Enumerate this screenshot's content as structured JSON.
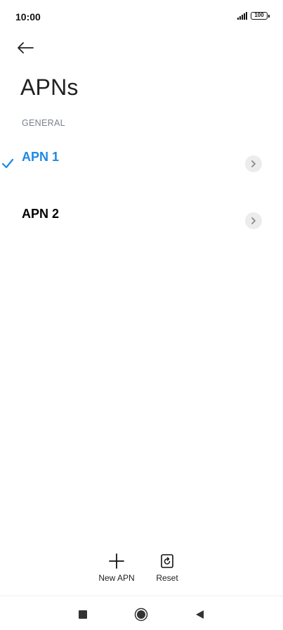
{
  "status_bar": {
    "time": "10:00",
    "battery": "100",
    "icons": [
      "signal-icon",
      "battery-icon"
    ]
  },
  "header": {
    "back_icon": "arrow-left-icon",
    "title": "APNs"
  },
  "section": {
    "header": "GENERAL"
  },
  "apns": [
    {
      "label": "APN 1",
      "selected": true
    },
    {
      "label": "APN 2",
      "selected": false
    }
  ],
  "actions": {
    "new_apn_label": "New APN",
    "reset_label": "Reset"
  },
  "nav_bar": {
    "icons": [
      "recent-apps-icon",
      "home-icon",
      "back-triangle-icon"
    ]
  },
  "colors": {
    "accent": "#1e88e5",
    "chevron_bg": "#ececec",
    "section_header": "#7a7f8c"
  }
}
